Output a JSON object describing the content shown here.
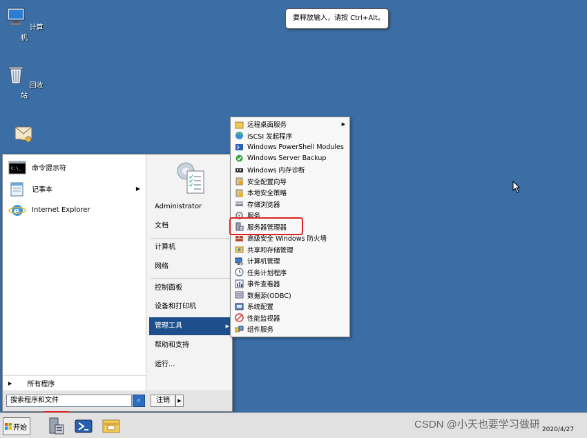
{
  "desktop": {
    "icons": [
      {
        "label": "计算机",
        "icon": "computer-icon"
      },
      {
        "label": "回收站",
        "icon": "recycle-bin-icon"
      },
      {
        "label": "",
        "icon": "mail-key-icon"
      }
    ]
  },
  "tooltip": {
    "text": "要释放输入，请按 Ctrl+Alt。"
  },
  "start_menu": {
    "programs": [
      {
        "label": "命令提示符",
        "icon": "cmd-icon"
      },
      {
        "label": "记事本",
        "icon": "notepad-icon",
        "has_submenu": true
      },
      {
        "label": "Internet Explorer",
        "icon": "ie-icon"
      }
    ],
    "all_programs": "所有程序",
    "search_placeholder": "搜索程序和文件",
    "logout": "注销",
    "right": {
      "user": "Administrator",
      "items": [
        "文档",
        "计算机",
        "网络",
        "控制面板",
        "设备和打印机",
        "管理工具",
        "帮助和支持",
        "运行..."
      ],
      "selected": "管理工具"
    }
  },
  "admin_tools": {
    "items": [
      {
        "label": "远程桌面服务",
        "icon": "folder-icon",
        "has_submenu": true
      },
      {
        "label": "iSCSI 发起程序",
        "icon": "globe-icon"
      },
      {
        "label": "Windows PowerShell Modules",
        "icon": "powershell-icon"
      },
      {
        "label": "Windows Server Backup",
        "icon": "backup-icon"
      },
      {
        "label": "Windows 内存诊断",
        "icon": "memory-icon"
      },
      {
        "label": "安全配置向导",
        "icon": "security-wizard-icon"
      },
      {
        "label": "本地安全策略",
        "icon": "policy-icon"
      },
      {
        "label": "存储浏览器",
        "icon": "storage-icon"
      },
      {
        "label": "服务",
        "icon": "services-icon"
      },
      {
        "label": "服务器管理器",
        "icon": "server-manager-icon"
      },
      {
        "label": "高级安全 Windows 防火墙",
        "icon": "firewall-icon"
      },
      {
        "label": "共享和存储管理",
        "icon": "share-icon"
      },
      {
        "label": "计算机管理",
        "icon": "computer-management-icon"
      },
      {
        "label": "任务计划程序",
        "icon": "clock-icon"
      },
      {
        "label": "事件查看器",
        "icon": "event-viewer-icon"
      },
      {
        "label": "数据源(ODBC)",
        "icon": "database-icon"
      },
      {
        "label": "系统配置",
        "icon": "system-config-icon"
      },
      {
        "label": "性能监视器",
        "icon": "performance-icon"
      },
      {
        "label": "组件服务",
        "icon": "component-icon"
      }
    ],
    "highlighted": "服务器管理器"
  },
  "taskbar": {
    "start_label": "开始",
    "pinned": [
      "server-manager-icon",
      "powershell-icon",
      "explorer-icon"
    ],
    "clock_date": "2020/4/27",
    "watermark": "CSDN @小天也要学习做研"
  },
  "colors": {
    "desktop": "#3a6ea5",
    "selection": "#1c4f8c",
    "highlight": "#e02020"
  }
}
